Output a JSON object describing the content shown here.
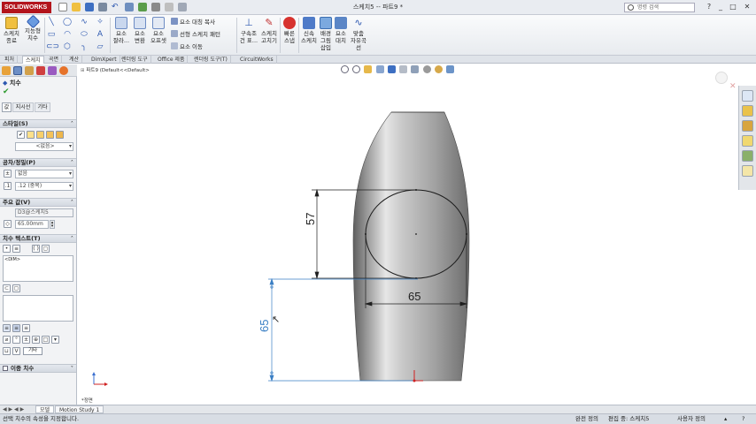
{
  "titlebar": {
    "brand": "SOLIDWORKS",
    "title": "스케치5 -- 파트9 *",
    "search_placeholder": "명령 검색",
    "window_controls": [
      "_",
      "□",
      "✕"
    ]
  },
  "ribbon": {
    "main_buttons": [
      {
        "label1": "스케치",
        "label2": "종료",
        "icon": "exit-sketch-icon"
      },
      {
        "label1": "지능형",
        "label2": "치수",
        "icon": "smart-dimension-icon"
      }
    ],
    "entity_buttons": [
      {
        "label1": "요소",
        "label2": "잘라...",
        "icon": "trim-icon"
      },
      {
        "label1": "요소",
        "label2": "변환",
        "icon": "convert-icon"
      },
      {
        "label1": "요소",
        "label2": "오프셋",
        "icon": "offset-icon"
      }
    ],
    "small_items": [
      "요소 대칭 복사",
      "선형 스케치 패턴",
      "요소 이동"
    ],
    "right_buttons": [
      {
        "label1": "구속조",
        "label2": "건 표...",
        "icon": "relations-icon"
      },
      {
        "label1": "스케치",
        "label2": "고치기",
        "icon": "repair-sketch-icon"
      },
      {
        "label1": "빠른",
        "label2": "스냅",
        "icon": "quick-snap-icon"
      },
      {
        "label1": "신속",
        "label2": "스케치",
        "icon": "rapid-sketch-icon"
      },
      {
        "label1": "배경",
        "label2": "그림 삽입",
        "icon": "sketch-picture-icon"
      },
      {
        "label1": "요소",
        "label2": "대치",
        "icon": "replace-entity-icon"
      },
      {
        "label1": "맞춤",
        "label2": "자유곡선",
        "icon": "fit-spline-icon"
      }
    ]
  },
  "tabs": [
    "피처",
    "스케치",
    "곡면",
    "계산",
    "DimXpert",
    "렌더링 도구",
    "Office 제품",
    "렌더링 도구(T)",
    "CircuitWorks"
  ],
  "active_tab_index": 1,
  "property_manager": {
    "title": "치수",
    "subtabs": [
      "값",
      "지시선",
      "기타"
    ],
    "style_header": "스타일(S)",
    "style_value": "<없음>",
    "tolerance_header": "공차/정밀(P)",
    "tolerance_type": "없음",
    "precision": ".12 (중복)",
    "primary_header": "주요 값(V)",
    "primary_name": "D3@스케치5",
    "primary_value": "65.00mm",
    "dimtext_header": "치수 텍스트(T)",
    "dimtext_content": "<DIM>",
    "dimtext_tool": "기타",
    "dual_header": "이중 치수"
  },
  "viewport": {
    "tree_label": "파트9  (Default<<Default>",
    "view_name": "*정면",
    "dimensions": {
      "vertical_circle": "57",
      "horizontal_circle": "65",
      "offset": "65"
    }
  },
  "bottom_tabs": [
    "모델",
    "Motion Study 1"
  ],
  "active_bottom_tab": 0,
  "status": {
    "message": "선택 치수의 속성을 지정합니다.",
    "definition": "완전 정의",
    "editing": "편집 중: 스케치5",
    "units": "사용자 정의"
  },
  "colors": {
    "dimension_dark": "#1f1f1f",
    "dimension_driven": "#3a7fc4",
    "accent_red": "#b3141c"
  }
}
